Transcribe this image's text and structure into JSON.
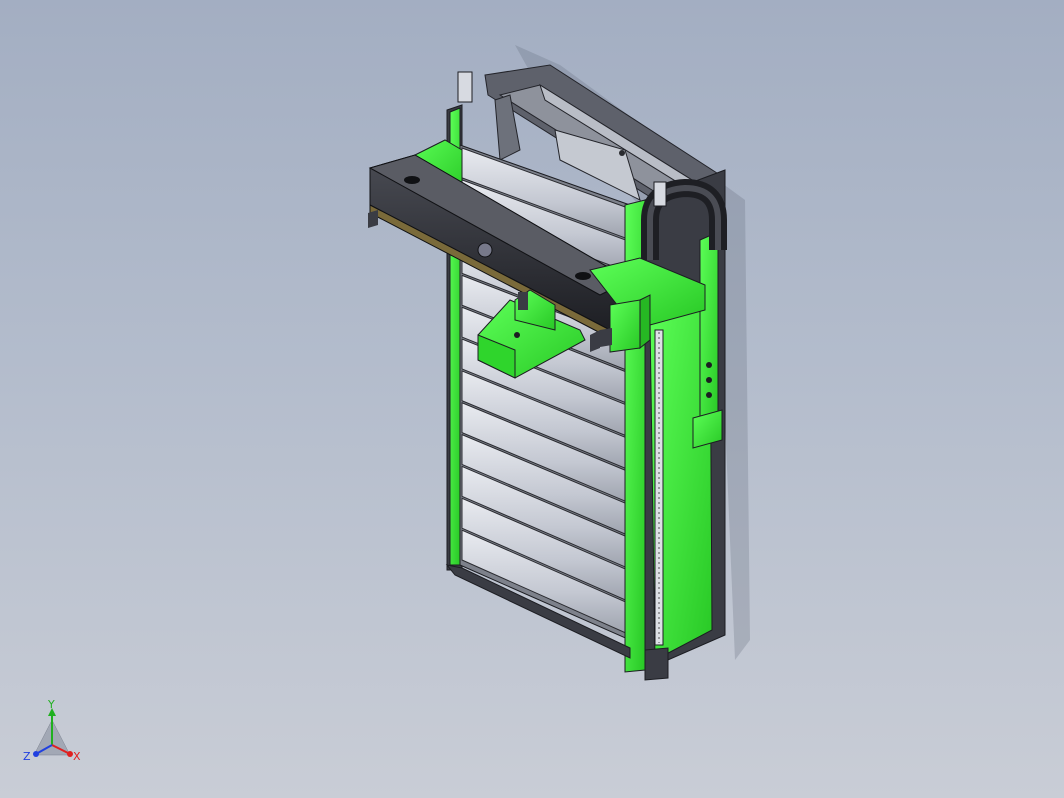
{
  "triad": {
    "x_label": "X",
    "y_label": "Y",
    "z_label": "Z",
    "x_color": "#e02020",
    "y_color": "#20b020",
    "z_color": "#2040e0"
  },
  "colors": {
    "background_top": "#a3aec2",
    "background_bottom": "#c9cdd6",
    "accent_green": "#3df03a",
    "frame_dark": "#3a3c44",
    "panel_gray": "#cfd3dc"
  }
}
